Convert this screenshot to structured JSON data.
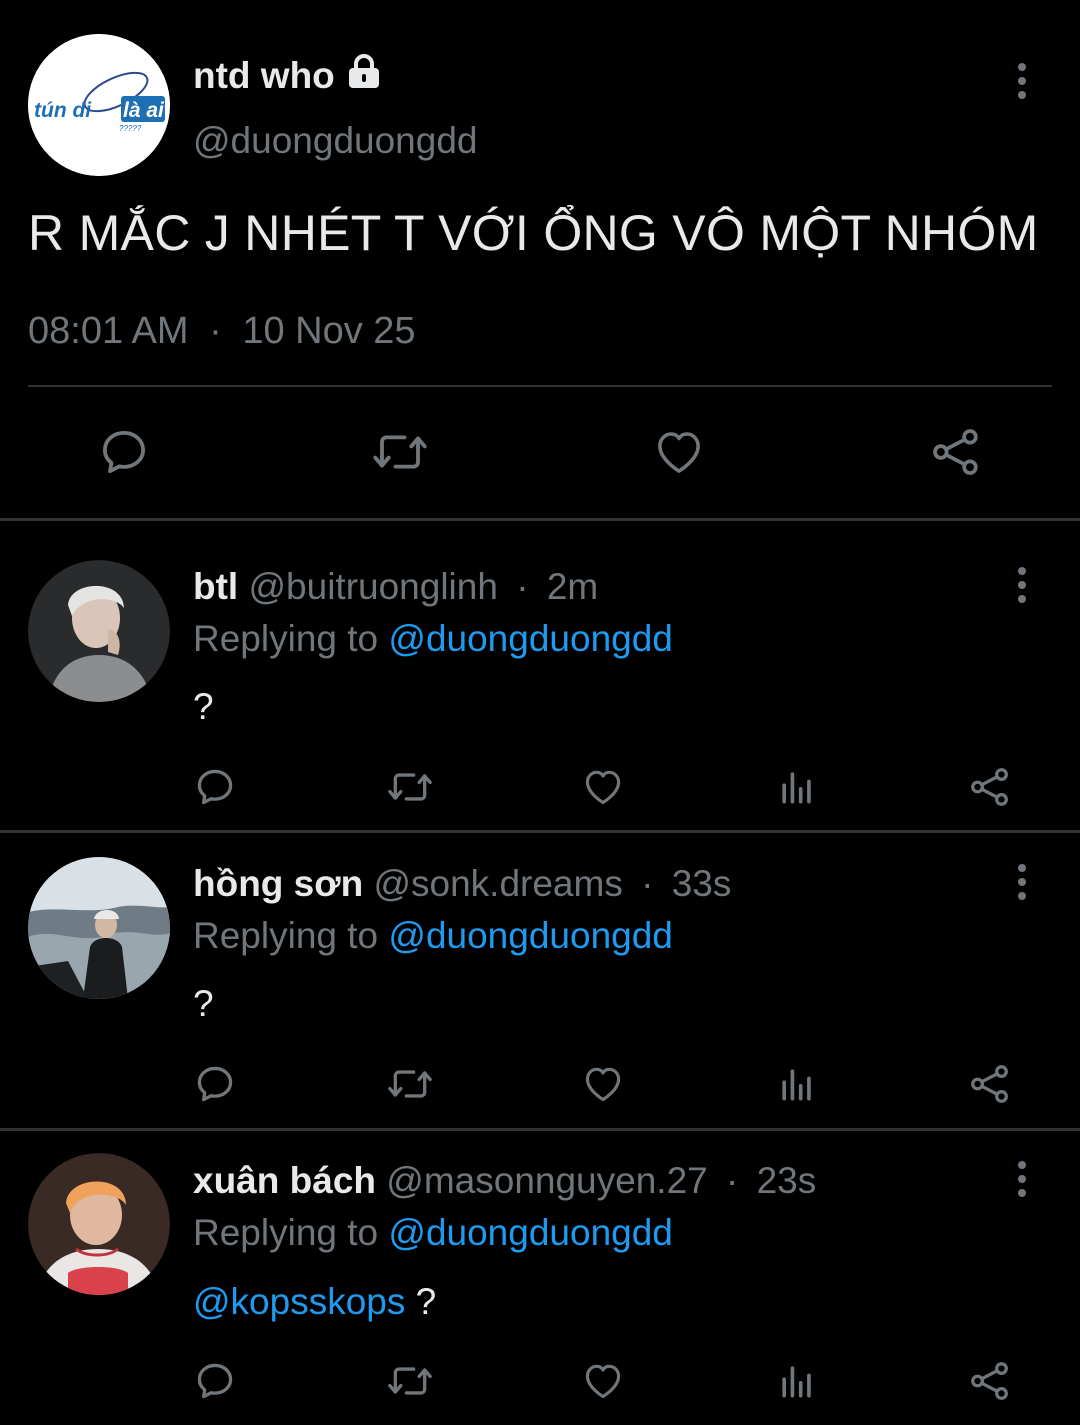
{
  "main_tweet": {
    "display_name": "ntd who",
    "handle": "@duongduongdd",
    "avatar_logo_text": "tún dilà ai",
    "avatar_logo_sub": "?????",
    "text": "R MẮC J NHÉT T VỚI ỔNG VÔ MỘT NHÓM",
    "time": "08:01 AM",
    "date_sep": "·",
    "date": "10 Nov 25"
  },
  "replies": [
    {
      "name": "btl",
      "handle": "@buitruonglinh",
      "sep": "·",
      "time": "2m",
      "replying_label": "Replying to",
      "replying_handle": "@duongduongdd",
      "mention": "",
      "body": "?"
    },
    {
      "name": "hồng sơn",
      "handle": "@sonk.dreams",
      "sep": "·",
      "time": "33s",
      "replying_label": "Replying to",
      "replying_handle": "@duongduongdd",
      "mention": "",
      "body": "?"
    },
    {
      "name": "xuân bách",
      "handle": "@masonnguyen.27",
      "sep": "·",
      "time": "23s",
      "replying_label": "Replying to",
      "replying_handle": "@duongduongdd",
      "mention": "@kopsskops",
      "body": " ?"
    }
  ],
  "icons": {
    "lock": "lock-icon",
    "more": "more-vertical-icon",
    "reply": "comment-icon",
    "retweet": "retweet-icon",
    "like": "heart-icon",
    "views": "views-chart-icon",
    "share": "share-icon"
  },
  "colors": {
    "background": "#000000",
    "text": "#e7e9ea",
    "muted": "#71767b",
    "link": "#1d9bf0",
    "divider": "#2f3336"
  }
}
